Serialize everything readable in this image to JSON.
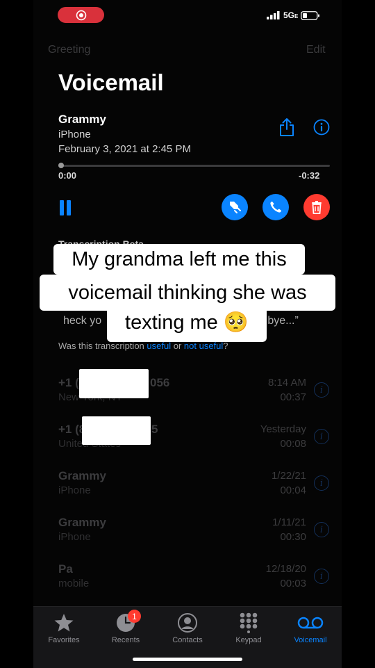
{
  "nav": {
    "greeting": "Greeting",
    "edit": "Edit",
    "title": "Voicemail"
  },
  "status": {
    "network": "5G",
    "network_suffix": "E"
  },
  "detail": {
    "caller": "Grammy",
    "label": "iPhone",
    "date": "February 3, 2021 at 2:45 PM",
    "elapsed": "0:00",
    "remaining": "-0:32",
    "transcription_heading": "Transcription Beta",
    "transcript_visible": "heck yo",
    "transcript_end": "n bye...”",
    "feedback_prefix": "Was this transcription ",
    "feedback_useful": "useful",
    "feedback_or": " or ",
    "feedback_not_useful": "not useful",
    "feedback_suffix": "?"
  },
  "caption": {
    "line1": "My grandma left me this",
    "line2": "voicemail thinking she was",
    "line3": "texting me 🥺"
  },
  "voicemails": [
    {
      "name_start": "+1 (",
      "name_end": "056",
      "sub": "New York, NY",
      "date": "8:14 AM",
      "duration": "00:37"
    },
    {
      "name_start": "+1 (8",
      "name_end": "5",
      "sub": "United States",
      "date": "Yesterday",
      "duration": "00:08"
    },
    {
      "name": "Grammy",
      "sub": "iPhone",
      "date": "1/22/21",
      "duration": "00:04"
    },
    {
      "name": "Grammy",
      "sub": "iPhone",
      "date": "1/11/21",
      "duration": "00:30"
    },
    {
      "name": "Pa",
      "sub": "mobile",
      "date": "12/18/20",
      "duration": "00:03"
    }
  ],
  "tabs": [
    {
      "label": "Favorites",
      "icon": "star-icon"
    },
    {
      "label": "Recents",
      "icon": "clock-icon",
      "badge": "1"
    },
    {
      "label": "Contacts",
      "icon": "person-circle-icon"
    },
    {
      "label": "Keypad",
      "icon": "keypad-icon"
    },
    {
      "label": "Voicemail",
      "icon": "voicemail-icon",
      "active": true
    }
  ],
  "colors": {
    "accent": "#0a84ff",
    "record": "#d9313b",
    "delete": "#ff3b30",
    "badge": "#ff3b30"
  }
}
